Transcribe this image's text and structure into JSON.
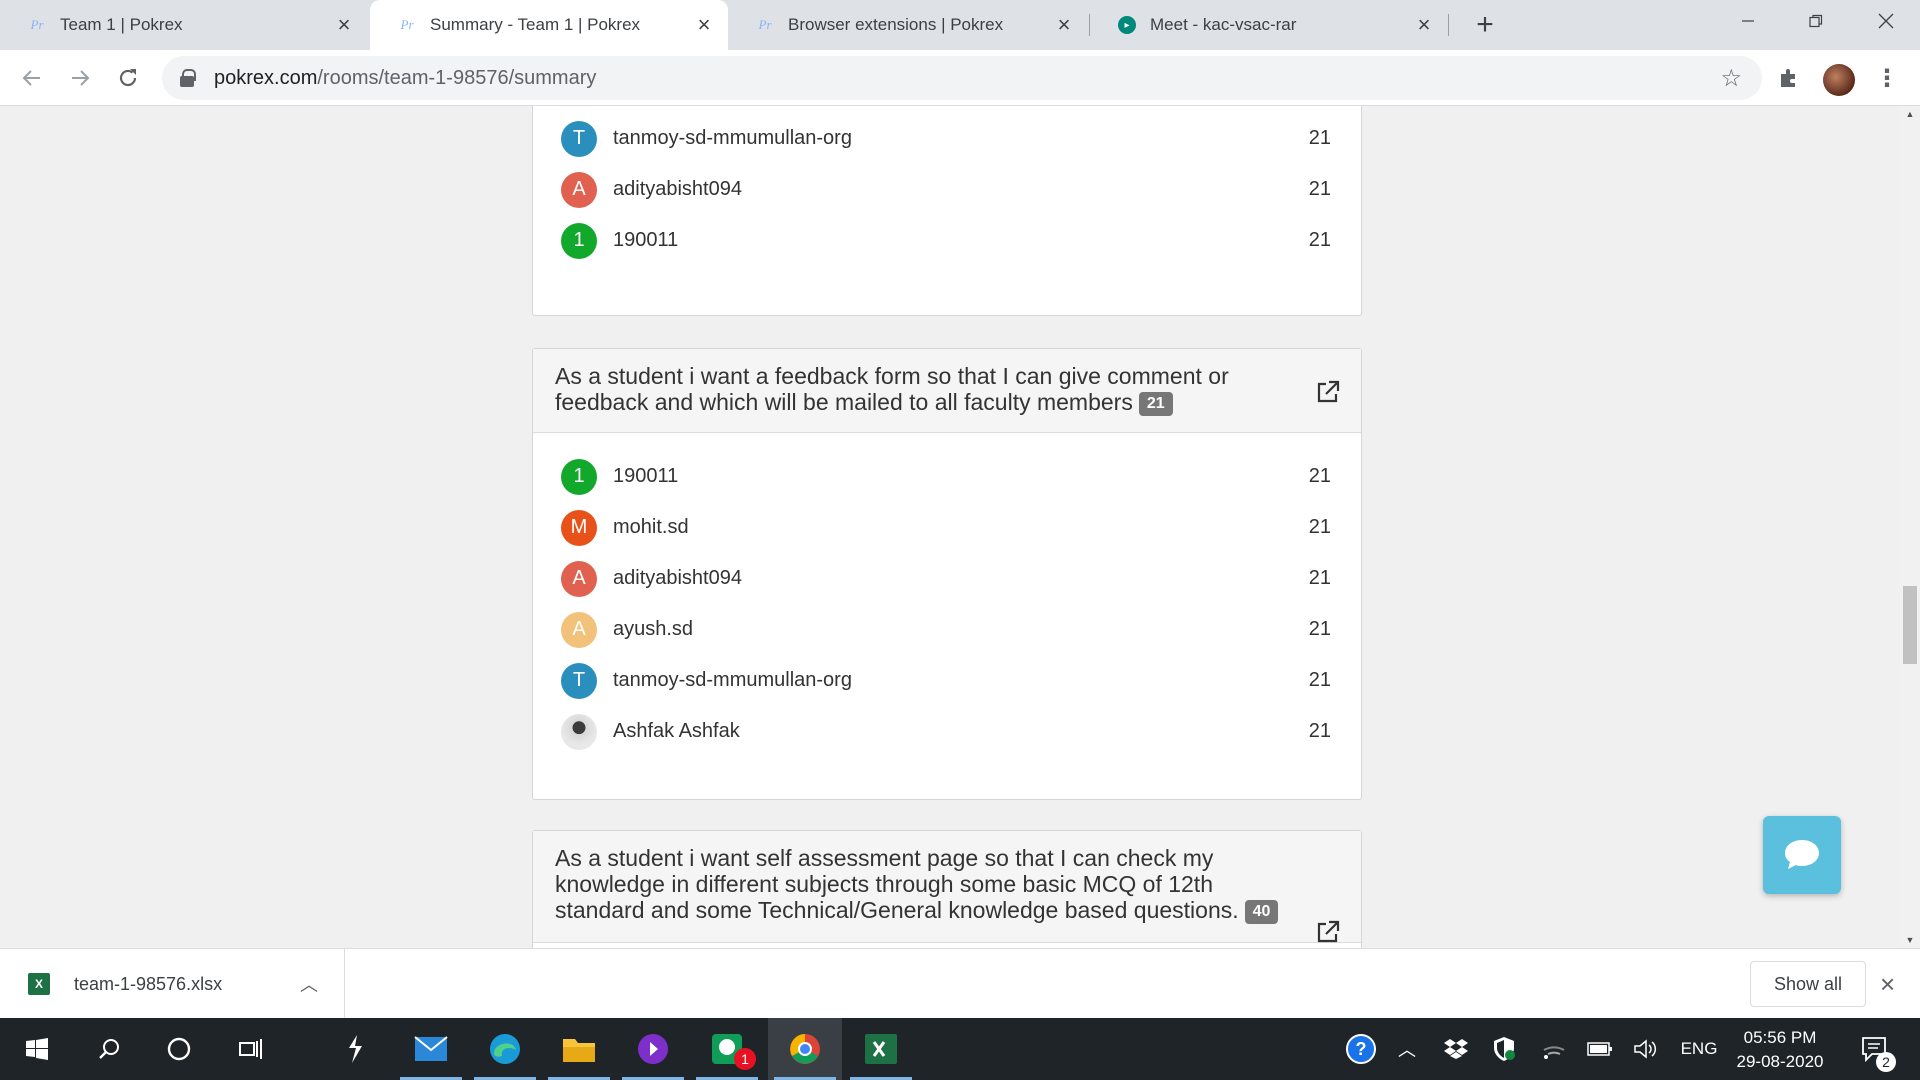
{
  "browser": {
    "tabs": [
      {
        "title": "Team 1 | Pokrex",
        "favicon": "Pr",
        "active": false
      },
      {
        "title": "Summary - Team 1 | Pokrex",
        "favicon": "Pr",
        "active": true
      },
      {
        "title": "Browser extensions | Pokrex",
        "favicon": "Pr",
        "active": false
      },
      {
        "title": "Meet - kac-vsac-rar",
        "favicon": "meet-icon",
        "active": false
      }
    ],
    "url_host": "pokrex.com",
    "url_path": "/rooms/team-1-98576/summary"
  },
  "cards": [
    {
      "rows": [
        {
          "initial": "T",
          "color": "#2a8fbd",
          "name": "tanmoy-sd-mmumullan-org",
          "score": "21"
        },
        {
          "initial": "A",
          "color": "#e0614f",
          "name": "adityabisht094",
          "score": "21"
        },
        {
          "initial": "1",
          "color": "#12a82c",
          "name": "190011",
          "score": "21"
        }
      ]
    },
    {
      "title": "As a student i want a feedback form so that I can give comment or feedback and which will be mailed to all faculty members",
      "badge": "21",
      "rows": [
        {
          "initial": "1",
          "color": "#12a82c",
          "name": "190011",
          "score": "21"
        },
        {
          "initial": "M",
          "color": "#e8511a",
          "name": "mohit.sd",
          "score": "21"
        },
        {
          "initial": "A",
          "color": "#e0614f",
          "name": "adityabisht094",
          "score": "21"
        },
        {
          "initial": "A",
          "color": "#f2c27a",
          "name": "ayush.sd",
          "score": "21"
        },
        {
          "initial": "T",
          "color": "#2a8fbd",
          "name": "tanmoy-sd-mmumullan-org",
          "score": "21"
        },
        {
          "initial": "",
          "color": "photo",
          "name": "Ashfak Ashfak",
          "score": "21"
        }
      ]
    },
    {
      "title": "As a student i want self assessment page so that I can check my knowledge in different subjects through some basic MCQ of 12th standard and some Technical/General knowledge based questions.",
      "badge": "40"
    }
  ],
  "download": {
    "filename": "team-1-98576.xlsx",
    "show_all": "Show all",
    "file_icon": "X"
  },
  "taskbar": {
    "time": "05:56 PM",
    "date": "29-08-2020",
    "lang": "ENG",
    "notification_count": "2",
    "app_badge": "1"
  },
  "colors": {
    "accent_chat": "#5bc0de",
    "badge_bg": "#777777"
  }
}
